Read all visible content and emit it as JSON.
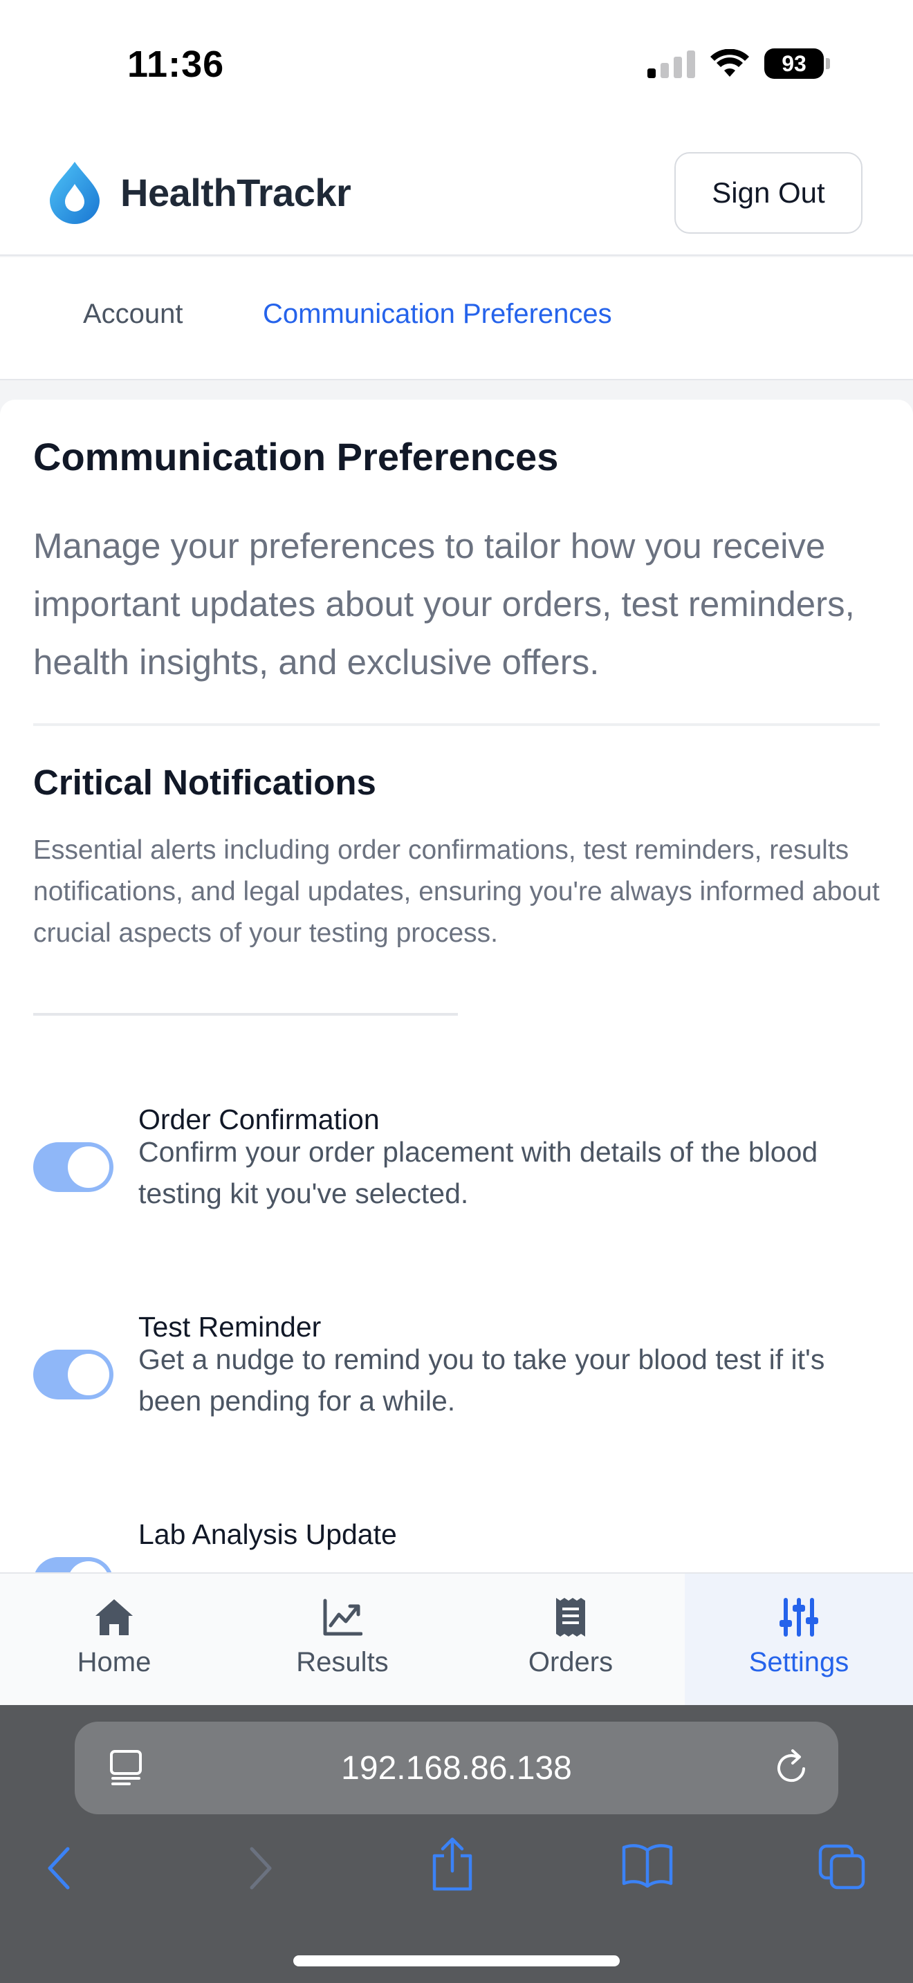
{
  "status_bar": {
    "time": "11:36",
    "battery": "93"
  },
  "header": {
    "brand": "HealthTrackr",
    "sign_out": "Sign Out"
  },
  "tabs": [
    {
      "label": "Account",
      "active": false
    },
    {
      "label": "Communication Preferences",
      "active": true
    }
  ],
  "main": {
    "title": "Communication Preferences",
    "description": "Manage your preferences to tailor how you receive important updates about your orders, test reminders, health insights, and exclusive offers.",
    "section": {
      "title": "Critical Notifications",
      "description": "Essential alerts including order confirmations, test reminders, results notifications, and legal updates, ensuring you're always informed about crucial aspects of your testing process."
    },
    "preferences": [
      {
        "label": "Order Confirmation",
        "description": "Confirm your order placement with details of the blood testing kit you've selected.",
        "enabled": true
      },
      {
        "label": "Test Reminder",
        "description": "Get a nudge to remind you to take your blood test if it's been pending for a while.",
        "enabled": true
      },
      {
        "label": "Lab Analysis Update",
        "description": "",
        "enabled": true
      }
    ]
  },
  "bottom_nav": [
    {
      "label": "Home",
      "icon": "home-icon",
      "active": false
    },
    {
      "label": "Results",
      "icon": "chart-icon",
      "active": false
    },
    {
      "label": "Orders",
      "icon": "receipt-icon",
      "active": false
    },
    {
      "label": "Settings",
      "icon": "sliders-icon",
      "active": true
    }
  ],
  "browser": {
    "url": "192.168.86.138"
  },
  "colors": {
    "accent": "#2563eb",
    "toggle_on": "#8fb7f8",
    "brand_drop": "#1e9be9"
  }
}
